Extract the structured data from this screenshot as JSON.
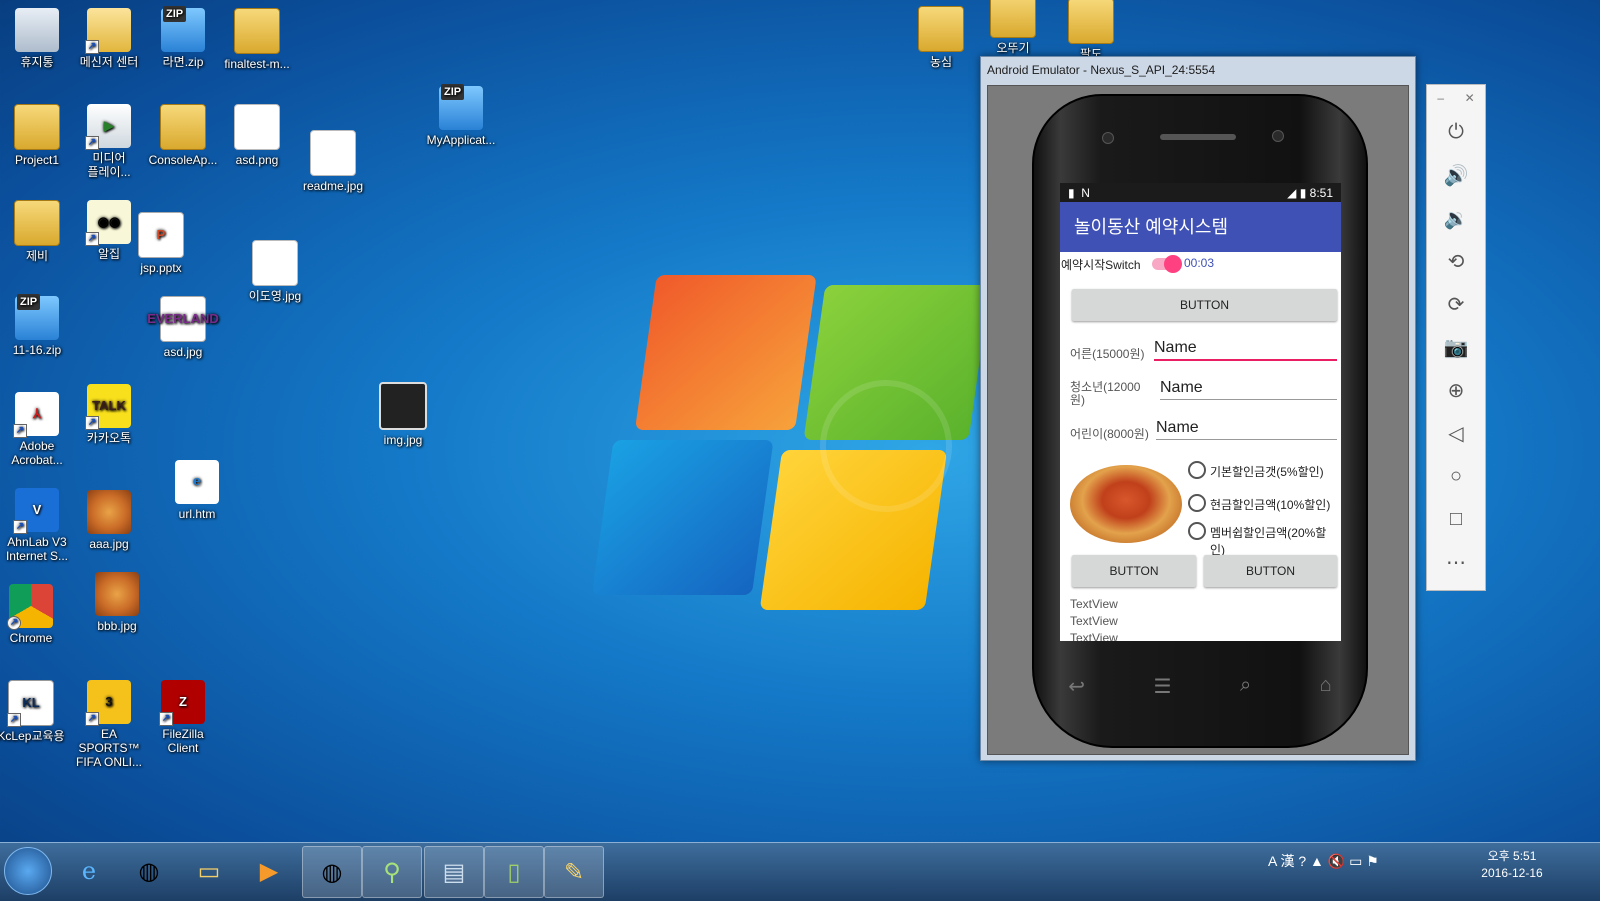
{
  "desktop": {
    "icons": [
      {
        "label": "휴지통"
      },
      {
        "label": "메신저 센터"
      },
      {
        "label": "라면.zip"
      },
      {
        "label": "finaltest-m..."
      },
      {
        "label": "Project1"
      },
      {
        "label": "미디어\n플레이..."
      },
      {
        "label": "ConsoleAp..."
      },
      {
        "label": "asd.png"
      },
      {
        "label": "readme.jpg"
      },
      {
        "label": "MyApplicat..."
      },
      {
        "label": "제비"
      },
      {
        "label": "알집"
      },
      {
        "label": "jsp.pptx"
      },
      {
        "label": "이도영.jpg"
      },
      {
        "label": "11-16.zip"
      },
      {
        "label": "asd.jpg"
      },
      {
        "label": "img.jpg"
      },
      {
        "label": "Adobe\nAcrobat..."
      },
      {
        "label": "카카오톡"
      },
      {
        "label": "url.htm"
      },
      {
        "label": "AhnLab V3\nInternet S..."
      },
      {
        "label": "aaa.jpg"
      },
      {
        "label": "Chrome"
      },
      {
        "label": "bbb.jpg"
      },
      {
        "label": "KcLep교육용"
      },
      {
        "label": "EA SPORTS™\nFIFA ONLI..."
      },
      {
        "label": "FileZilla\nClient"
      },
      {
        "label": "농심"
      },
      {
        "label": "오뚜기"
      },
      {
        "label": "팔도"
      }
    ]
  },
  "emulator": {
    "title": "Android Emulator - Nexus_S_API_24:5554",
    "status_time": "8:51",
    "app_title": "놀이동산 예약시스템",
    "switch_label": "예약시작Switch",
    "chronometer": "00:03",
    "button_top": "BUTTON",
    "adult_label": "어른(15000원)",
    "adult_value": "Name",
    "teen_label": "청소년(12000\n원)",
    "teen_value": "Name",
    "child_label": "어린이(8000원)",
    "child_value": "Name",
    "radios": [
      "기본할인금갯(5%할인)",
      "현금할인금액(10%할인)",
      "멤버쉽할인금액(20%할인)"
    ],
    "button_left": "BUTTON",
    "button_right": "BUTTON",
    "textviews": [
      "TextView",
      "TextView",
      "TextView"
    ]
  },
  "sidebar": {
    "controls": [
      "power-icon",
      "volume-up-icon",
      "volume-down-icon",
      "rotate-left-icon",
      "rotate-right-icon",
      "camera-icon",
      "zoom-icon",
      "back-icon",
      "home-icon",
      "overview-icon",
      "more-icon"
    ]
  },
  "taskbar": {
    "clock_time": "오후 5:51",
    "clock_date": "2016-12-16",
    "ime": "A 漢"
  }
}
